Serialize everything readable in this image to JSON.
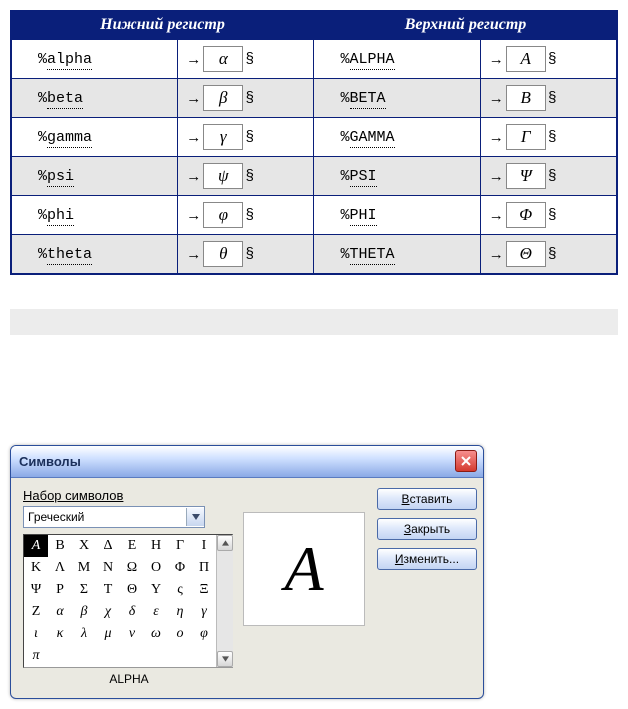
{
  "ref_table": {
    "header_lower": "Нижний регистр",
    "header_upper": "Верхний регистр",
    "arrow": "→",
    "section_mark": "§",
    "rows": [
      {
        "lower_code": "%alpha",
        "lower_sym": "α",
        "upper_code": "%ALPHA",
        "upper_sym": "A"
      },
      {
        "lower_code": "%beta",
        "lower_sym": "β",
        "upper_code": "%BETA",
        "upper_sym": "B"
      },
      {
        "lower_code": "%gamma",
        "lower_sym": "γ",
        "upper_code": "%GAMMA",
        "upper_sym": "Γ"
      },
      {
        "lower_code": "%psi",
        "lower_sym": "ψ",
        "upper_code": "%PSI",
        "upper_sym": "Ψ"
      },
      {
        "lower_code": "%phi",
        "lower_sym": "φ",
        "upper_code": "%PHI",
        "upper_sym": "Φ"
      },
      {
        "lower_code": "%theta",
        "lower_sym": "θ",
        "upper_code": "%THETA",
        "upper_sym": "Θ"
      }
    ]
  },
  "dialog": {
    "title": "Символы",
    "subset_label": "Набор символов",
    "subset_value": "Греческий",
    "selected_name": "ALPHA",
    "preview_symbol": "A",
    "buttons": {
      "insert": {
        "underline": "В",
        "rest": "ставить"
      },
      "close": {
        "underline": "З",
        "rest": "акрыть"
      },
      "edit": {
        "underline": "И",
        "rest": "зменить..."
      }
    },
    "grid": {
      "selected_index": 0,
      "cells": [
        "A",
        "B",
        "X",
        "Δ",
        "E",
        "H",
        "Γ",
        "I",
        "K",
        "Λ",
        "M",
        "N",
        "Ω",
        "O",
        "Φ",
        "Π",
        "Ψ",
        "P",
        "Σ",
        "T",
        "Θ",
        "Y",
        "ς",
        "Ξ",
        "Z",
        "α",
        "β",
        "χ",
        "δ",
        "ε",
        "η",
        "γ",
        "ι",
        "κ",
        "λ",
        "μ",
        "ν",
        "ω",
        "o",
        "φ",
        "π"
      ]
    }
  }
}
